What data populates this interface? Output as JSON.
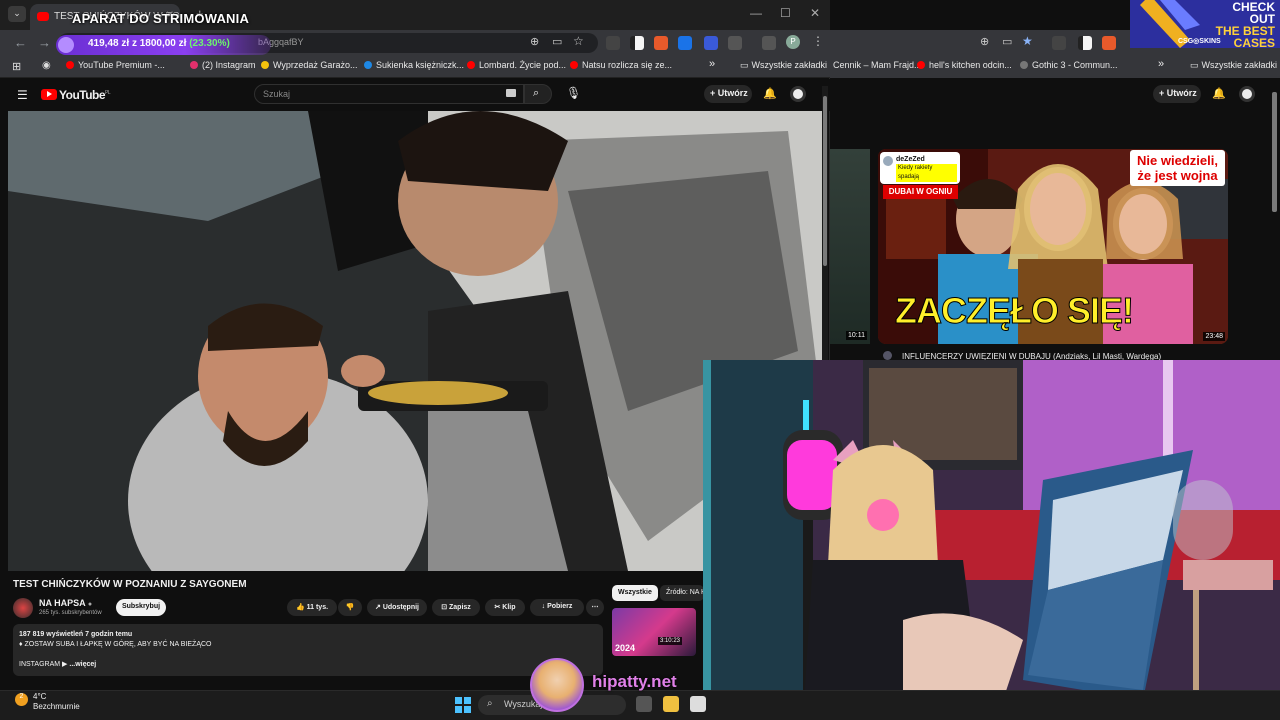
{
  "stream_overlay": {
    "title": "APARAT DO STRIMOWANIA",
    "goal_current": "419,48 zł",
    "goal_separator": "z",
    "goal_target": "1800,00 zł",
    "goal_percent": "(23.30%)",
    "goal_progress": 0.233,
    "url_fragment": "bAggqafBY"
  },
  "browser_left": {
    "tab_title": "TEST CHIŃCZYKÓW W PO",
    "bookmarks": [
      {
        "label": "YouTube Premium -...",
        "color": "#f00"
      },
      {
        "label": "(2) Instagram",
        "color": "#e1306c"
      },
      {
        "label": "Wyprzedaż Garażo...",
        "color": "#f4c20d"
      },
      {
        "label": "Sukienka księżniczk...",
        "color": "#1e88e5"
      },
      {
        "label": "Lombard. Życie pod...",
        "color": "#f00"
      },
      {
        "label": "Natsu rozlicza się ze...",
        "color": "#f00"
      }
    ],
    "bookmarks_more": "»",
    "all_bookmarks": "Wszystkie zakładki"
  },
  "youtube": {
    "logo": "YouTube",
    "logo_region": "PL",
    "search_placeholder": "Szukaj",
    "create_label": "Utwórz",
    "video_title": "TEST CHIŃCZYKÓW W POZNANIU Z SAYGONEM",
    "channel_name": "NA HAPSA",
    "channel_subs": "265 tys. subskrybentów",
    "subscribe_label": "Subskrybuj",
    "likes": "11 tys.",
    "share_label": "Udostępnij",
    "save_label": "Zapisz",
    "clip_label": "Klip",
    "download_label": "Pobierz",
    "views_line": "187 819 wyświetleń  7 godzin temu",
    "desc_line": "♦ ZOSTAW SUBA I ŁAPKĘ W GÓRĘ, ABY BYĆ NA BIEŻĄCO",
    "desc_more_prefix": "INSTAGRAM ▶",
    "desc_more": "...więcej",
    "chips": [
      "Wszystkie",
      "Źródło: NA H"
    ],
    "side_thumb_year": "2024",
    "side_thumb_duration": "3:10:23"
  },
  "browser_right": {
    "bookmarks": [
      "Cennik – Mam Frajd...",
      "hell's kitchen odcin...",
      "Gothic 3 - Commun..."
    ],
    "bookmarks_more": "»",
    "all_bookmarks": "Wszystkie zakładki",
    "create_label": "Utwórz",
    "left_duration": "10:11",
    "main_duration": "23:48",
    "thumb_headline": "ZACZĘŁO SIĘ!",
    "thumb_callout": "Nie wiedzieli, że jest wojna",
    "thumb_badge": "DUBAI W OGNIU",
    "thumb_tweet_name": "deZeZed",
    "thumb_tweet_sub": "Kiedy rakiety spadają",
    "video_title": "INFLUENCERZY UWIĘZIENI W DUBAJU (Andziaks, Lil Masti, Wardęga)"
  },
  "ad_banner": {
    "line1": "CHECK OUT",
    "line2": "THE BEST",
    "line3": "CASES",
    "brand": "CSG◎SKINS"
  },
  "taskbar": {
    "temperature": "4°C",
    "weather": "Bezchmurnie",
    "search_placeholder": "Wyszukaj",
    "watermark": "hipatty.net"
  }
}
